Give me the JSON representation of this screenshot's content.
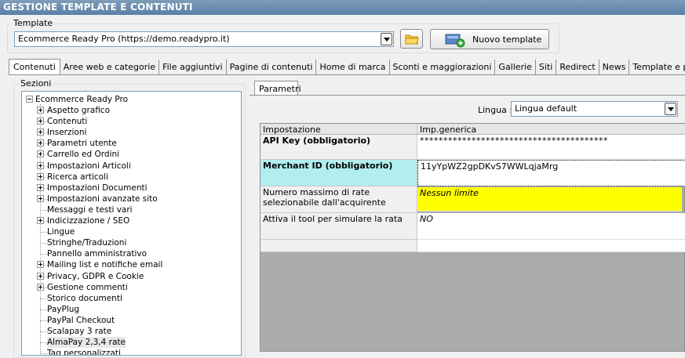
{
  "window": {
    "title": "GESTIONE TEMPLATE E CONTENUTI"
  },
  "template_group": {
    "legend": "Template",
    "selected": "Ecommerce Ready Pro (https://demo.readypro.it)",
    "new_button_label": "Nuovo template"
  },
  "tabs": [
    {
      "label": "Contenuti",
      "active": true
    },
    {
      "label": "Aree web e categorie"
    },
    {
      "label": "File aggiuntivi"
    },
    {
      "label": "Pagine di contenuti"
    },
    {
      "label": "Home di marca"
    },
    {
      "label": "Sconti e maggiorazioni"
    },
    {
      "label": "Gallerie"
    },
    {
      "label": "Siti"
    },
    {
      "label": "Redirect"
    },
    {
      "label": "News"
    },
    {
      "label": "Template e plugins"
    }
  ],
  "sections": {
    "legend": "Sezioni",
    "root": "Ecommerce Ready Pro",
    "items": [
      {
        "label": "Aspetto grafico",
        "expandable": true
      },
      {
        "label": "Contenuti",
        "expandable": true
      },
      {
        "label": "Inserzioni",
        "expandable": true
      },
      {
        "label": "Parametri utente",
        "expandable": true
      },
      {
        "label": "Carrello ed Ordini",
        "expandable": true
      },
      {
        "label": "Impostazioni Articoli",
        "expandable": true
      },
      {
        "label": "Ricerca articoli",
        "expandable": true
      },
      {
        "label": "Impostazioni Documenti",
        "expandable": true
      },
      {
        "label": "Impostazioni avanzate sito",
        "expandable": true
      },
      {
        "label": "Messaggi e testi vari",
        "expandable": false
      },
      {
        "label": "Indicizzazione / SEO",
        "expandable": true
      },
      {
        "label": "Lingue",
        "expandable": false
      },
      {
        "label": "Stringhe/Traduzioni",
        "expandable": false
      },
      {
        "label": "Pannello amministrativo",
        "expandable": false
      },
      {
        "label": "Mailing list e notifiche email",
        "expandable": true
      },
      {
        "label": "Privacy, GDPR e Cookie",
        "expandable": true
      },
      {
        "label": "Gestione commenti",
        "expandable": true
      },
      {
        "label": "Storico documenti",
        "expandable": false
      },
      {
        "label": "PayPlug",
        "expandable": false
      },
      {
        "label": "PayPal Checkout",
        "expandable": false
      },
      {
        "label": "Scalapay 3 rate",
        "expandable": false
      },
      {
        "label": "AlmaPay 2,3,4 rate",
        "expandable": false,
        "selected": true
      },
      {
        "label": "Tag personalizzati",
        "expandable": false
      }
    ]
  },
  "params": {
    "tab_label": "Parametri",
    "language_label": "Lingua :",
    "language_value": "Lingua default",
    "col_setting": "Impostazione",
    "col_value": "Imp.generica",
    "rows": [
      {
        "name": "API Key (obbligatorio)",
        "value": "****************************************"
      },
      {
        "name": "Merchant ID (obbligatorio)",
        "value": "11yYpWZ2gpDKvS7WWLqjaMrg"
      },
      {
        "name": "Numero massimo di rate selezionabile dall'acquirente",
        "value": "Nessun limite"
      },
      {
        "name": "Attiva il tool per simulare la rata",
        "value": "NO"
      }
    ]
  },
  "colors": {
    "title_bar": "#5a7fa8",
    "merchant_highlight": "#b2eeee",
    "yellow_highlight": "#ffff00"
  }
}
